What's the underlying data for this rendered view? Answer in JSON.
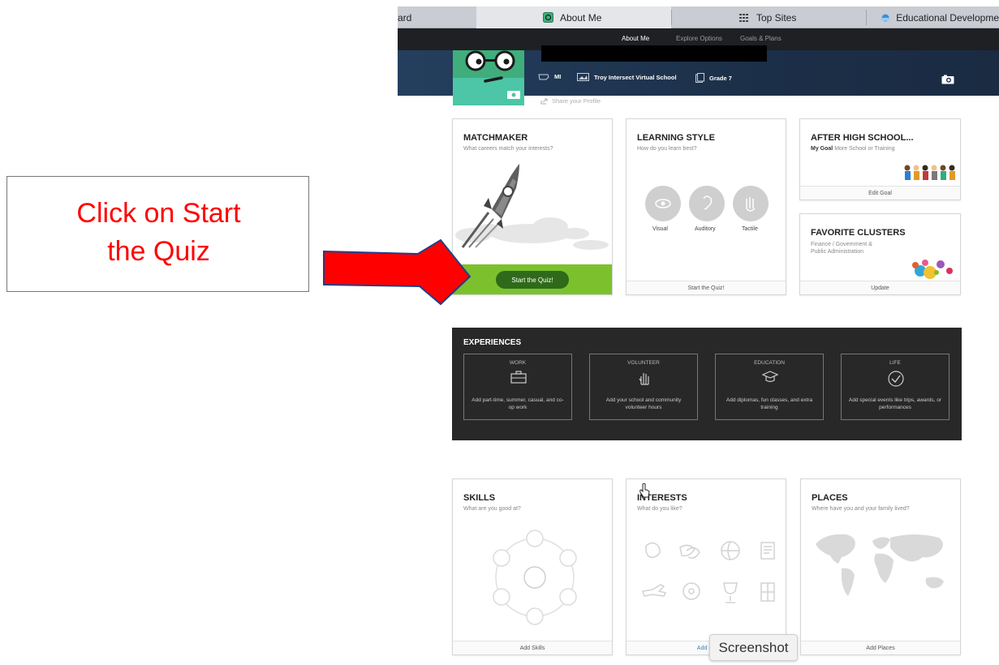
{
  "browser": {
    "tabs": [
      {
        "label": "ard",
        "active": false
      },
      {
        "label": "About Me",
        "active": true
      },
      {
        "label": "Top Sites",
        "active": false
      },
      {
        "label": "Educational Developme",
        "active": false
      }
    ]
  },
  "nav": {
    "items": [
      "About Me",
      "Explore Options",
      "Goals & Plans"
    ],
    "active": "About Me"
  },
  "profile": {
    "state": "MI",
    "school": "Troy Intersect Virtual School",
    "grade": "Grade 7",
    "share_label": "Share your Profile"
  },
  "cards": {
    "matchmaker": {
      "title": "MATCHMAKER",
      "subtitle": "What careers match your interests?",
      "button": "Start the Quiz!"
    },
    "learning_style": {
      "title": "LEARNING STYLE",
      "subtitle": "How do you learn best?",
      "options": [
        "Visual",
        "Auditory",
        "Tactile"
      ],
      "footer": "Start the Quiz!"
    },
    "after_high_school": {
      "title": "AFTER HIGH SCHOOL...",
      "goal_label": "My Goal",
      "goal_value": "More School or Training",
      "footer": "Edit Goal"
    },
    "favorite_clusters": {
      "title": "FAVORITE CLUSTERS",
      "line1": "Finance  /  Government &",
      "line2": "Public Administration",
      "footer": "Update"
    },
    "skills": {
      "title": "SKILLS",
      "subtitle": "What are you good at?",
      "footer": "Add Skills"
    },
    "interests": {
      "title": "INTERESTS",
      "subtitle": "What do you like?",
      "footer": "Add Int"
    },
    "places": {
      "title": "PLACES",
      "subtitle": "Where have you and your family lived?",
      "footer": "Add Places"
    }
  },
  "experiences": {
    "title": "EXPERIENCES",
    "items": [
      {
        "label": "WORK",
        "desc": "Add part-time, summer, casual, and co-op work",
        "icon": "briefcase-icon"
      },
      {
        "label": "VOLUNTEER",
        "desc": "Add your school and community volunteer hours",
        "icon": "hand-icon"
      },
      {
        "label": "EDUCATION",
        "desc": "Add diplomas, fun classes, and extra training",
        "icon": "graduation-cap-icon"
      },
      {
        "label": "LIFE",
        "desc": "Add special events like trips, awards, or performances",
        "icon": "checkmark-icon"
      }
    ]
  },
  "annotation": {
    "line1": "Click on Start",
    "line2": "the Quiz"
  },
  "tooltip": "Screenshot",
  "colors": {
    "accent_green": "#7cc12d",
    "button_green": "#2f6a1a",
    "arrow_red": "#ff0000",
    "annotation_red": "#ff0000"
  }
}
